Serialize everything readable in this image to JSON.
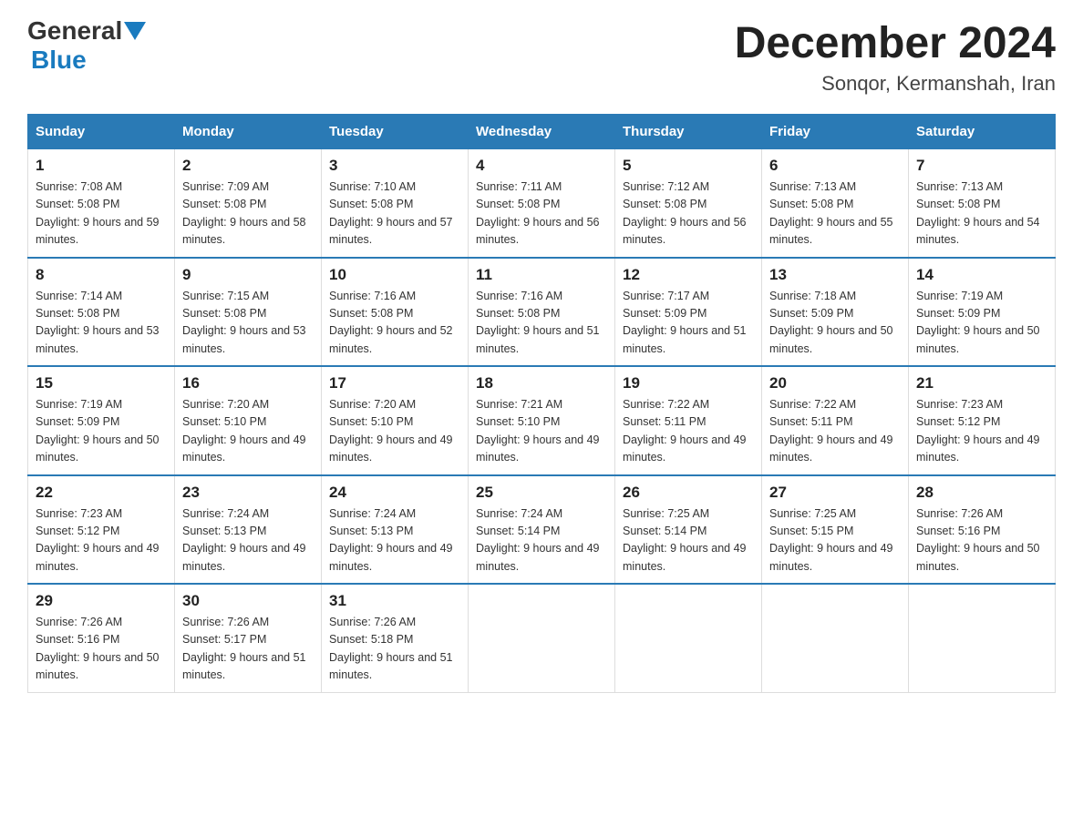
{
  "logo": {
    "general": "General",
    "blue": "Blue"
  },
  "title": "December 2024",
  "location": "Sonqor, Kermanshah, Iran",
  "weekdays": [
    "Sunday",
    "Monday",
    "Tuesday",
    "Wednesday",
    "Thursday",
    "Friday",
    "Saturday"
  ],
  "weeks": [
    [
      {
        "day": "1",
        "sunrise": "7:08 AM",
        "sunset": "5:08 PM",
        "daylight": "9 hours and 59 minutes."
      },
      {
        "day": "2",
        "sunrise": "7:09 AM",
        "sunset": "5:08 PM",
        "daylight": "9 hours and 58 minutes."
      },
      {
        "day": "3",
        "sunrise": "7:10 AM",
        "sunset": "5:08 PM",
        "daylight": "9 hours and 57 minutes."
      },
      {
        "day": "4",
        "sunrise": "7:11 AM",
        "sunset": "5:08 PM",
        "daylight": "9 hours and 56 minutes."
      },
      {
        "day": "5",
        "sunrise": "7:12 AM",
        "sunset": "5:08 PM",
        "daylight": "9 hours and 56 minutes."
      },
      {
        "day": "6",
        "sunrise": "7:13 AM",
        "sunset": "5:08 PM",
        "daylight": "9 hours and 55 minutes."
      },
      {
        "day": "7",
        "sunrise": "7:13 AM",
        "sunset": "5:08 PM",
        "daylight": "9 hours and 54 minutes."
      }
    ],
    [
      {
        "day": "8",
        "sunrise": "7:14 AM",
        "sunset": "5:08 PM",
        "daylight": "9 hours and 53 minutes."
      },
      {
        "day": "9",
        "sunrise": "7:15 AM",
        "sunset": "5:08 PM",
        "daylight": "9 hours and 53 minutes."
      },
      {
        "day": "10",
        "sunrise": "7:16 AM",
        "sunset": "5:08 PM",
        "daylight": "9 hours and 52 minutes."
      },
      {
        "day": "11",
        "sunrise": "7:16 AM",
        "sunset": "5:08 PM",
        "daylight": "9 hours and 51 minutes."
      },
      {
        "day": "12",
        "sunrise": "7:17 AM",
        "sunset": "5:09 PM",
        "daylight": "9 hours and 51 minutes."
      },
      {
        "day": "13",
        "sunrise": "7:18 AM",
        "sunset": "5:09 PM",
        "daylight": "9 hours and 50 minutes."
      },
      {
        "day": "14",
        "sunrise": "7:19 AM",
        "sunset": "5:09 PM",
        "daylight": "9 hours and 50 minutes."
      }
    ],
    [
      {
        "day": "15",
        "sunrise": "7:19 AM",
        "sunset": "5:09 PM",
        "daylight": "9 hours and 50 minutes."
      },
      {
        "day": "16",
        "sunrise": "7:20 AM",
        "sunset": "5:10 PM",
        "daylight": "9 hours and 49 minutes."
      },
      {
        "day": "17",
        "sunrise": "7:20 AM",
        "sunset": "5:10 PM",
        "daylight": "9 hours and 49 minutes."
      },
      {
        "day": "18",
        "sunrise": "7:21 AM",
        "sunset": "5:10 PM",
        "daylight": "9 hours and 49 minutes."
      },
      {
        "day": "19",
        "sunrise": "7:22 AM",
        "sunset": "5:11 PM",
        "daylight": "9 hours and 49 minutes."
      },
      {
        "day": "20",
        "sunrise": "7:22 AM",
        "sunset": "5:11 PM",
        "daylight": "9 hours and 49 minutes."
      },
      {
        "day": "21",
        "sunrise": "7:23 AM",
        "sunset": "5:12 PM",
        "daylight": "9 hours and 49 minutes."
      }
    ],
    [
      {
        "day": "22",
        "sunrise": "7:23 AM",
        "sunset": "5:12 PM",
        "daylight": "9 hours and 49 minutes."
      },
      {
        "day": "23",
        "sunrise": "7:24 AM",
        "sunset": "5:13 PM",
        "daylight": "9 hours and 49 minutes."
      },
      {
        "day": "24",
        "sunrise": "7:24 AM",
        "sunset": "5:13 PM",
        "daylight": "9 hours and 49 minutes."
      },
      {
        "day": "25",
        "sunrise": "7:24 AM",
        "sunset": "5:14 PM",
        "daylight": "9 hours and 49 minutes."
      },
      {
        "day": "26",
        "sunrise": "7:25 AM",
        "sunset": "5:14 PM",
        "daylight": "9 hours and 49 minutes."
      },
      {
        "day": "27",
        "sunrise": "7:25 AM",
        "sunset": "5:15 PM",
        "daylight": "9 hours and 49 minutes."
      },
      {
        "day": "28",
        "sunrise": "7:26 AM",
        "sunset": "5:16 PM",
        "daylight": "9 hours and 50 minutes."
      }
    ],
    [
      {
        "day": "29",
        "sunrise": "7:26 AM",
        "sunset": "5:16 PM",
        "daylight": "9 hours and 50 minutes."
      },
      {
        "day": "30",
        "sunrise": "7:26 AM",
        "sunset": "5:17 PM",
        "daylight": "9 hours and 51 minutes."
      },
      {
        "day": "31",
        "sunrise": "7:26 AM",
        "sunset": "5:18 PM",
        "daylight": "9 hours and 51 minutes."
      },
      null,
      null,
      null,
      null
    ]
  ],
  "sunrise_label": "Sunrise:",
  "sunset_label": "Sunset:",
  "daylight_label": "Daylight:"
}
